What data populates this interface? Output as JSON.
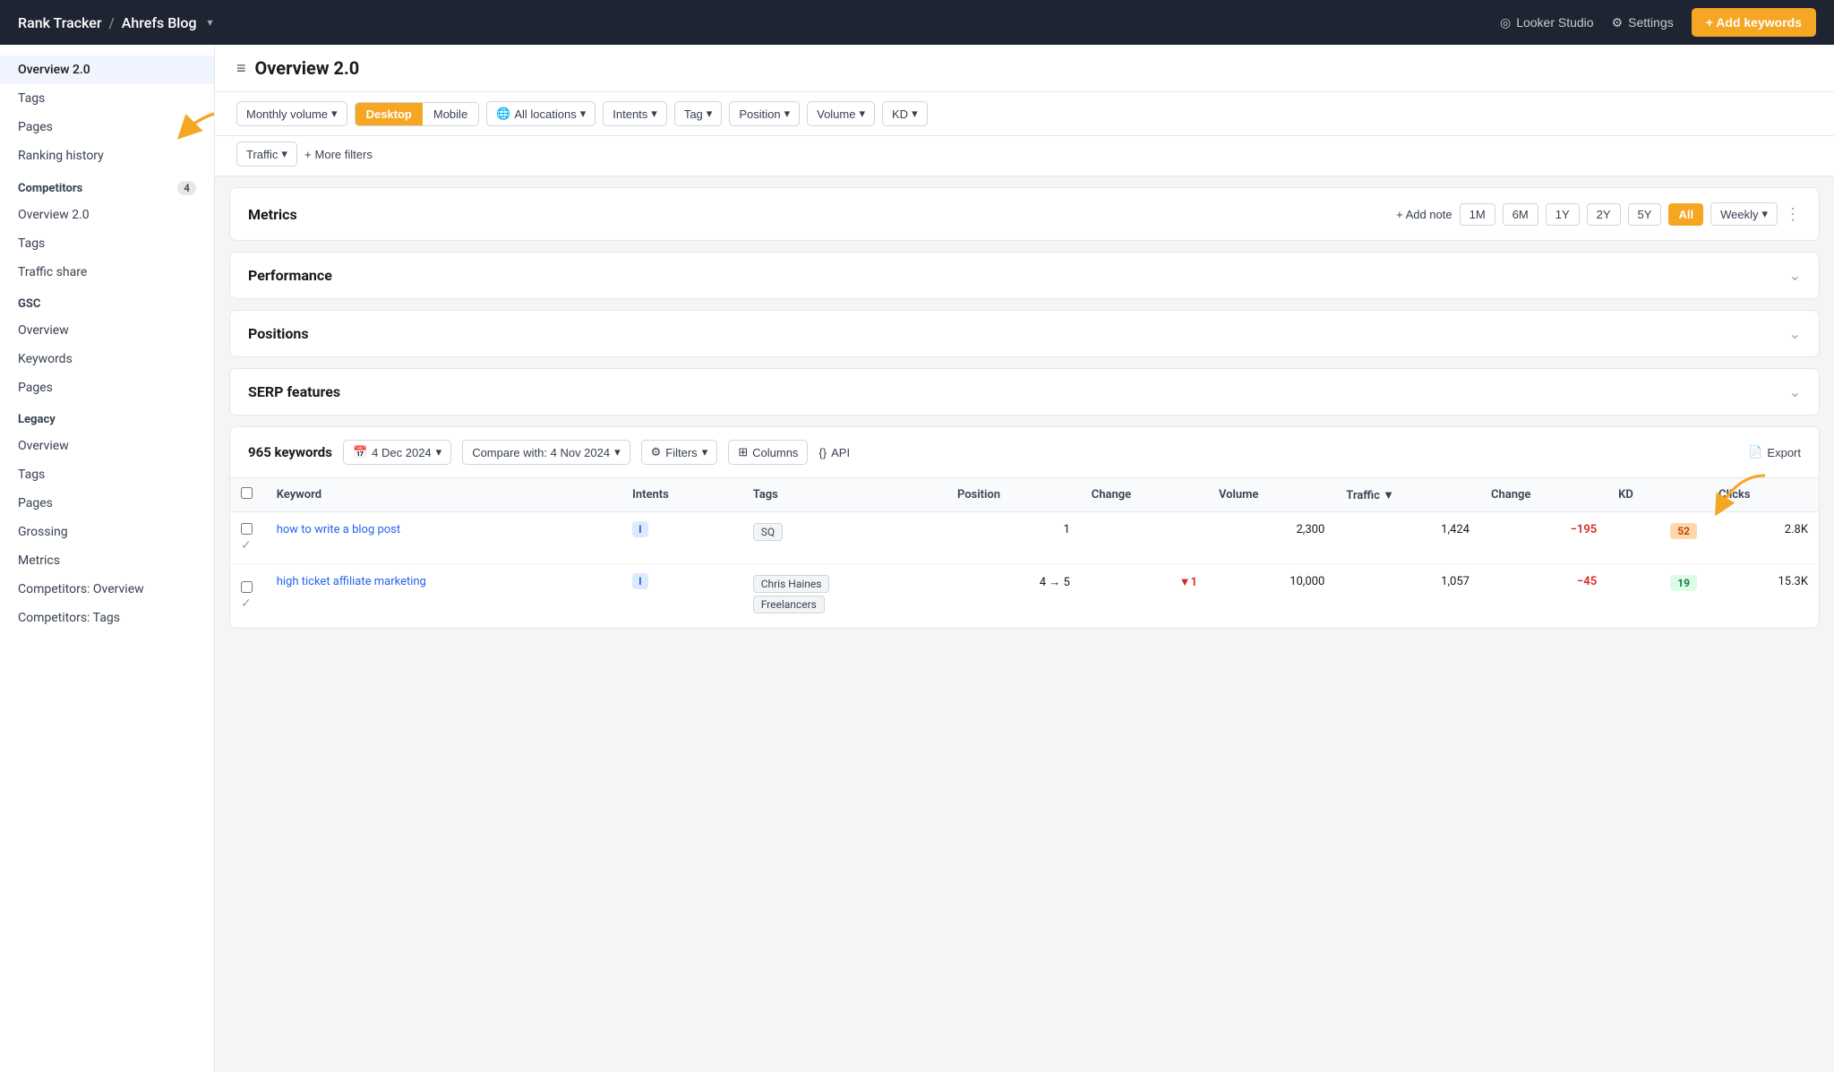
{
  "topnav": {
    "breadcrumb_part1": "Rank Tracker",
    "separator": "/",
    "breadcrumb_part2": "Ahrefs Blog",
    "looker_studio": "Looker Studio",
    "settings": "Settings",
    "add_keywords": "+ Add keywords"
  },
  "sidebar": {
    "top_items": [
      {
        "label": "Overview 2.0",
        "active": true
      },
      {
        "label": "Tags",
        "active": false
      },
      {
        "label": "Pages",
        "active": false
      },
      {
        "label": "Ranking history",
        "active": false
      }
    ],
    "competitors_header": "Competitors",
    "competitors_badge": "4",
    "competitors_items": [
      {
        "label": "Overview 2.0"
      },
      {
        "label": "Tags"
      },
      {
        "label": "Traffic share"
      }
    ],
    "gsc_header": "GSC",
    "gsc_items": [
      {
        "label": "Overview"
      },
      {
        "label": "Keywords"
      },
      {
        "label": "Pages"
      }
    ],
    "legacy_header": "Legacy",
    "legacy_items": [
      {
        "label": "Overview"
      },
      {
        "label": "Tags"
      },
      {
        "label": "Pages"
      },
      {
        "label": "Grossing"
      },
      {
        "label": "Metrics"
      },
      {
        "label": "Competitors: Overview"
      },
      {
        "label": "Competitors: Tags"
      }
    ]
  },
  "page": {
    "title": "Overview 2.0"
  },
  "filters": {
    "monthly_volume": "Monthly volume",
    "desktop": "Desktop",
    "mobile": "Mobile",
    "all_locations": "All locations",
    "intents": "Intents",
    "tag": "Tag",
    "position": "Position",
    "volume": "Volume",
    "kd": "KD",
    "traffic": "Traffic",
    "more_filters": "More filters"
  },
  "metrics": {
    "title": "Metrics",
    "add_note": "+ Add note",
    "time_buttons": [
      "1M",
      "6M",
      "1Y",
      "2Y",
      "5Y",
      "All"
    ],
    "active_time": "All",
    "weekly": "Weekly"
  },
  "performance": {
    "title": "Performance"
  },
  "positions": {
    "title": "Positions"
  },
  "serp_features": {
    "title": "SERP features"
  },
  "keywords_section": {
    "count": "965 keywords",
    "date": "4 Dec 2024",
    "compare_with": "Compare with: 4 Nov 2024",
    "filters": "Filters",
    "columns": "Columns",
    "api": "API",
    "export": "Export",
    "columns_headers": [
      "Keyword",
      "Intents",
      "Tags",
      "Position",
      "Change",
      "Volume",
      "Traffic",
      "Change",
      "KD",
      "Clicks"
    ],
    "rows": [
      {
        "keyword": "how to write a blog post",
        "intent": "I",
        "tags": [
          "SQ"
        ],
        "position": "1",
        "change": "",
        "volume": "2,300",
        "traffic": "1,424",
        "traffic_change": "−195",
        "kd": "52",
        "kd_class": "kd-orange",
        "clicks": "2.8K",
        "verified": true
      },
      {
        "keyword": "high ticket affiliate marketing",
        "intent": "I",
        "tags": [
          "Chris Haines",
          "Freelancers"
        ],
        "position": "4 → 5",
        "position_down": true,
        "change": "▼1",
        "volume": "10,000",
        "traffic": "1,057",
        "traffic_change": "−45",
        "kd": "19",
        "kd_class": "kd-green",
        "clicks": "15.3K",
        "verified": true
      }
    ]
  }
}
